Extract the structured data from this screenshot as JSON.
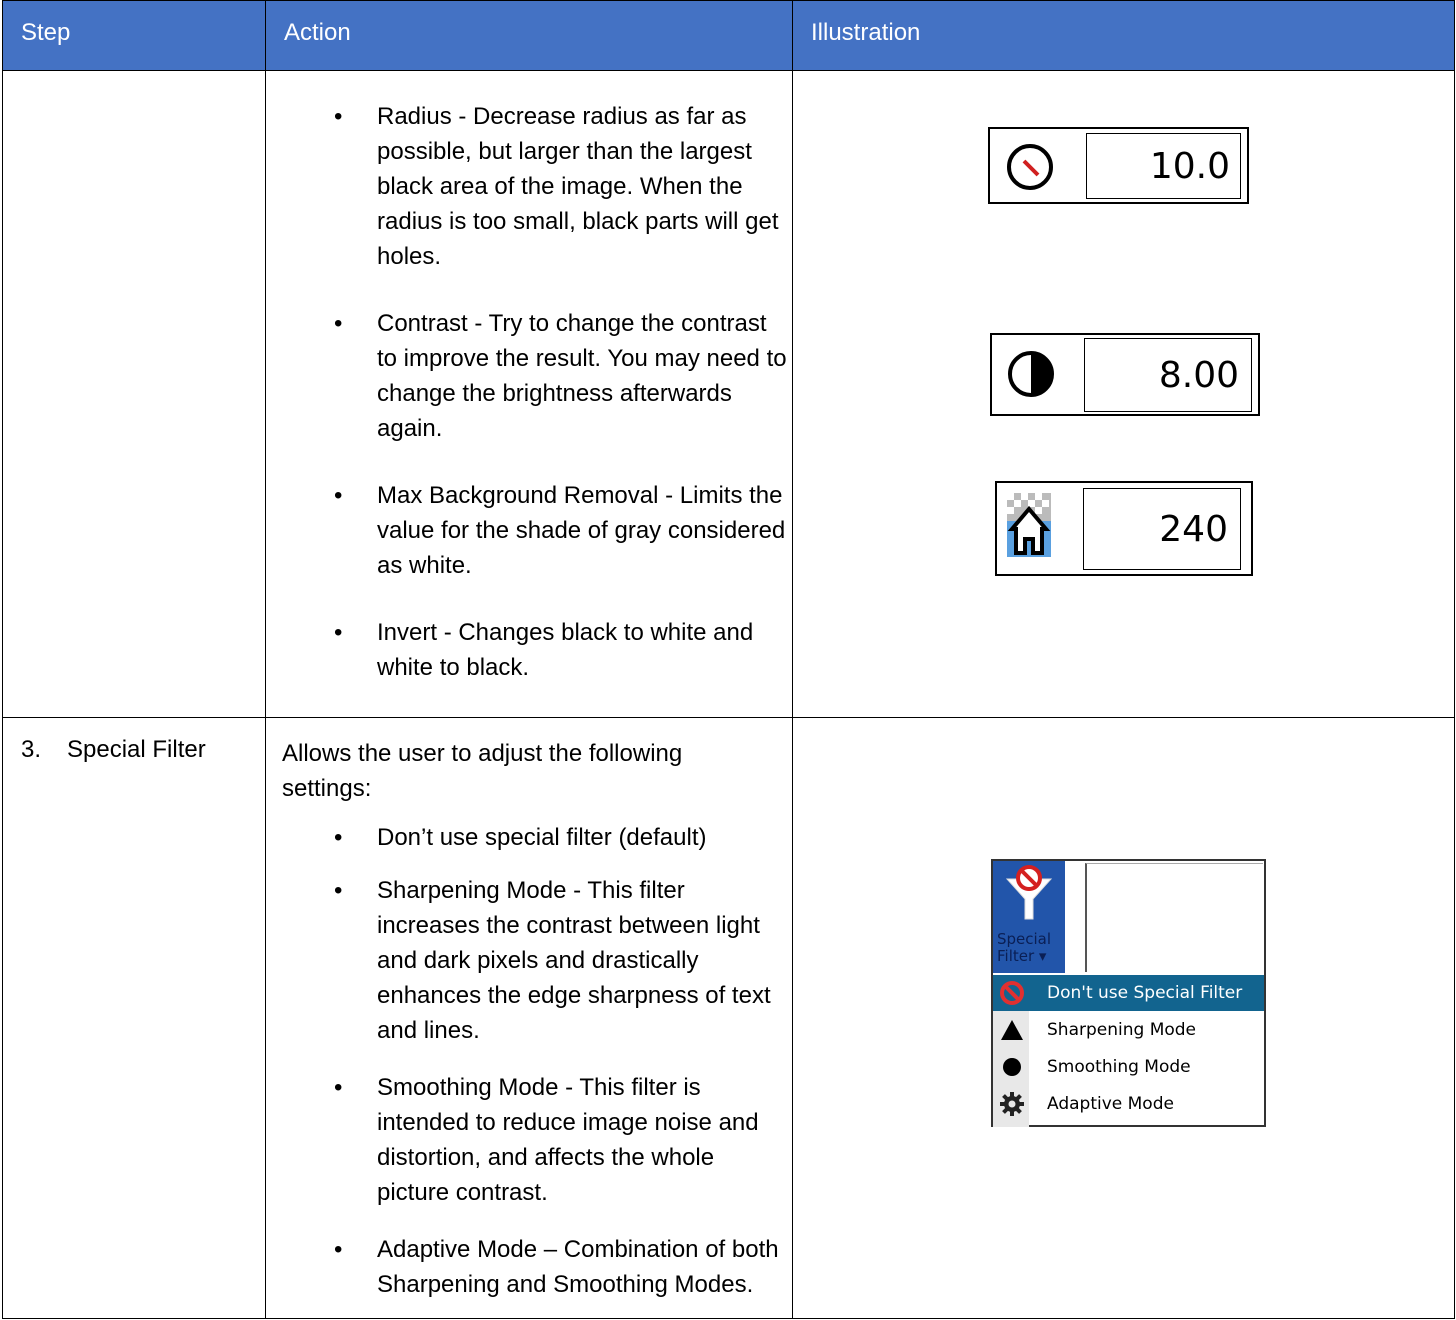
{
  "header": {
    "step": "Step",
    "action": "Action",
    "illustration": "Illustration"
  },
  "row1": {
    "bullets": [
      "Radius - Decrease radius as far as possible, but larger than the largest black area of the image. When the radius is too small, black parts will get holes.",
      "Contrast - Try to change the contrast to improve the result. You may need to change the brightness afterwards again.",
      "Max Background Removal - Limits the value for the shade of gray considered as white.",
      "Invert -  Changes black to white and white to black."
    ],
    "widgets": {
      "radius_value": "10.0",
      "contrast_value": "8.00",
      "background_value": "240"
    }
  },
  "row2": {
    "step_number": "3.",
    "step_label": "Special Filter",
    "intro": "Allows the user to adjust the following settings:",
    "bullets": [
      "Don’t use special filter (default)",
      "Sharpening Mode - This filter increases the contrast between light and dark pixels and drastically enhances the edge sharpness of text and lines.",
      "Smoothing Mode - This filter is intended to reduce image noise and distortion, and affects the whole picture contrast.",
      "Adaptive Mode – Combination of both Sharpening and Smoothing Modes."
    ],
    "menu": {
      "button_label_line1": "Special",
      "button_label_line2": "Filter ▾",
      "items": [
        "Don't use Special Filter",
        "Sharpening Mode",
        "Smoothing Mode",
        "Adaptive Mode"
      ],
      "selected_color": "#12648f",
      "button_color": "#2255aa"
    }
  },
  "colors": {
    "header_bg": "#4472c4",
    "header_text": "#ffffff"
  }
}
